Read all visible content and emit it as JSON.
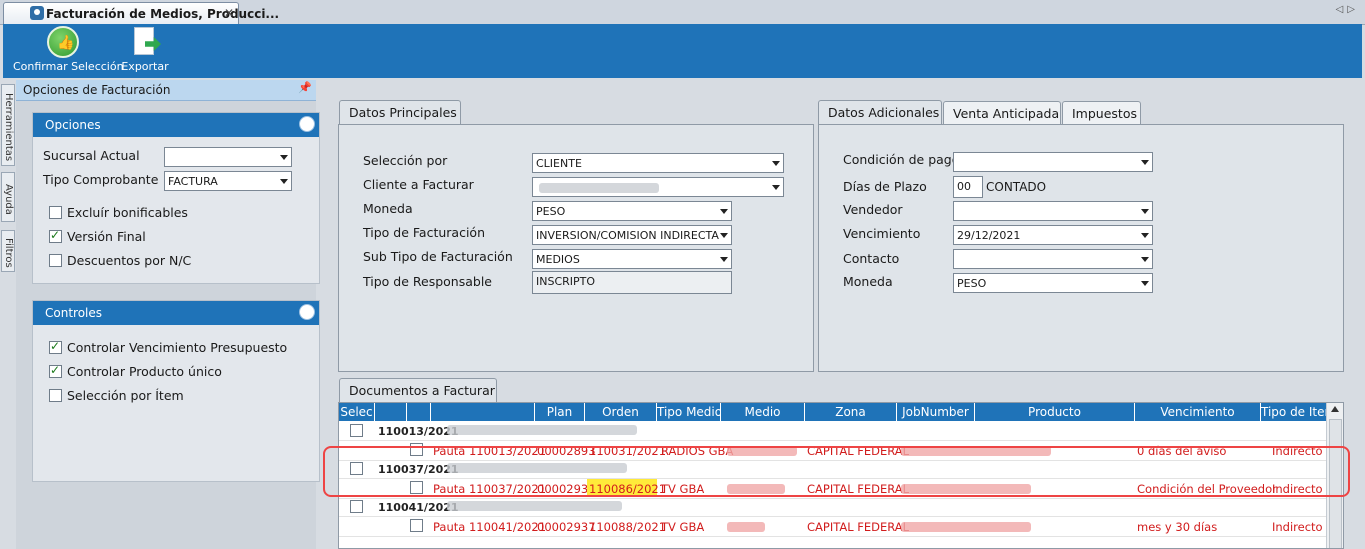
{
  "window": {
    "title": "Facturación de Medios, Producci..."
  },
  "ribbon": {
    "confirm_label": "Confirmar Selección",
    "export_label": "Exportar"
  },
  "side_tabs": [
    "Herramientas",
    "Ayuda",
    "Filtros"
  ],
  "options_panel": {
    "title": "Opciones de Facturación",
    "opciones": {
      "title": "Opciones",
      "sucursal_label": "Sucursal Actual",
      "sucursal_value": "",
      "tipo_comprobante_label": "Tipo Comprobante",
      "tipo_comprobante_value": "FACTURA",
      "checks": [
        {
          "label": "Excluír bonificables",
          "checked": false
        },
        {
          "label": "Versión Final",
          "checked": true
        },
        {
          "label": "Descuentos por N/C",
          "checked": false
        }
      ]
    },
    "controles": {
      "title": "Controles",
      "checks": [
        {
          "label": "Controlar Vencimiento Presupuesto",
          "checked": true
        },
        {
          "label": "Controlar Producto único",
          "checked": true
        },
        {
          "label": "Selección por Ítem",
          "checked": false
        }
      ]
    }
  },
  "principales": {
    "tab": "Datos Principales",
    "fields": [
      {
        "label": "Selección por",
        "value": "CLIENTE"
      },
      {
        "label": "Cliente a Facturar",
        "value": ""
      },
      {
        "label": "Moneda",
        "value": "PESO"
      },
      {
        "label": "Tipo de Facturación",
        "value": "INVERSION/COMISION INDIRECTA"
      },
      {
        "label": "Sub Tipo de Facturación",
        "value": "MEDIOS"
      },
      {
        "label": "Tipo de Responsable",
        "value": "INSCRIPTO"
      }
    ]
  },
  "adicionales": {
    "tabs": [
      "Datos Adicionales",
      "Venta Anticipada",
      "Impuestos"
    ],
    "fields": [
      {
        "label": "Condición de pago",
        "value": ""
      },
      {
        "label": "Días de Plazo",
        "value": "00",
        "suffix": "CONTADO"
      },
      {
        "label": "Vendedor",
        "value": ""
      },
      {
        "label": "Vencimiento",
        "value": "29/12/2021"
      },
      {
        "label": "Contacto",
        "value": ""
      },
      {
        "label": "Moneda",
        "value": "PESO"
      }
    ]
  },
  "documentos": {
    "tab": "Documentos a Facturar",
    "columns": [
      "Selec",
      "",
      "",
      "",
      "Plan",
      "Orden",
      "Tipo Medio",
      "Medio",
      "Zona",
      "JobNumber",
      "Producto",
      "Vencimiento",
      "Tipo de Item"
    ],
    "groups": [
      {
        "id": "110013/2021",
        "item": {
          "pauta": "Pauta 110013/2021",
          "plan": "00002893",
          "orden": "110031/2021",
          "tipo_medio": "RADIOS GBA",
          "zona": "CAPITAL FEDERAL",
          "vencimiento": "0 días del aviso",
          "tipo_item": "Indirecto"
        }
      },
      {
        "id": "110037/2021",
        "item": {
          "pauta": "Pauta 110037/2021",
          "plan": "00002930",
          "orden": "110086/2021",
          "tipo_medio": "TV GBA",
          "zona": "CAPITAL FEDERAL",
          "vencimiento": "Condición del Proveedor",
          "tipo_item": "Indirecto"
        }
      },
      {
        "id": "110041/2021",
        "item": {
          "pauta": "Pauta 110041/2021",
          "plan": "00002937",
          "orden": "110088/2021",
          "tipo_medio": "TV GBA",
          "zona": "CAPITAL FEDERAL",
          "vencimiento": "mes y 30 días",
          "tipo_item": "Indirecto"
        }
      }
    ]
  },
  "colors": {
    "accent": "#1f73b8",
    "row_text": "#d11c1c",
    "highlight": "#ffea3a",
    "annotation": "#e44444"
  }
}
